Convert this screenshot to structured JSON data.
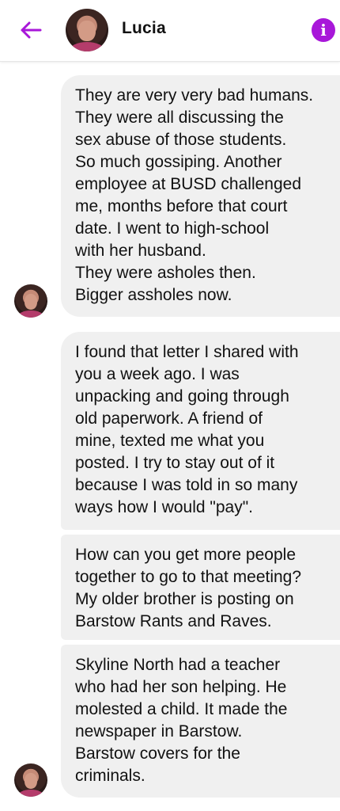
{
  "header": {
    "contact_name": "Lucia",
    "back_icon": "arrow-left-icon",
    "info_icon": "info-icon",
    "accent_color": "#a817d9"
  },
  "messages": [
    {
      "text": "They are very very bad humans.\nThey were all discussing the\nsex abuse of those students.\nSo much gossiping.  Another\nemployee at BUSD challenged\nme, months before that court\ndate.  I went to high-school\nwith her husband.\nThey were asholes then.\nBigger assholes now."
    },
    {
      "text": "I found that letter I shared with\nyou a week ago.  I was\nunpacking and going through\nold paperwork.  A friend of\nmine, texted me what you\nposted.  I try to stay out of it\nbecause I was told in so many\nways how I would \"pay\"."
    },
    {
      "text": "How can you get more people\ntogether to go to that meeting?\nMy older brother is posting on\nBarstow Rants and Raves."
    },
    {
      "text": "Skyline North had a teacher\nwho had her son helping.  He\nmolested a child.  It made the\nnewspaper in Barstow.\nBarstow covers for the\ncriminals."
    }
  ]
}
